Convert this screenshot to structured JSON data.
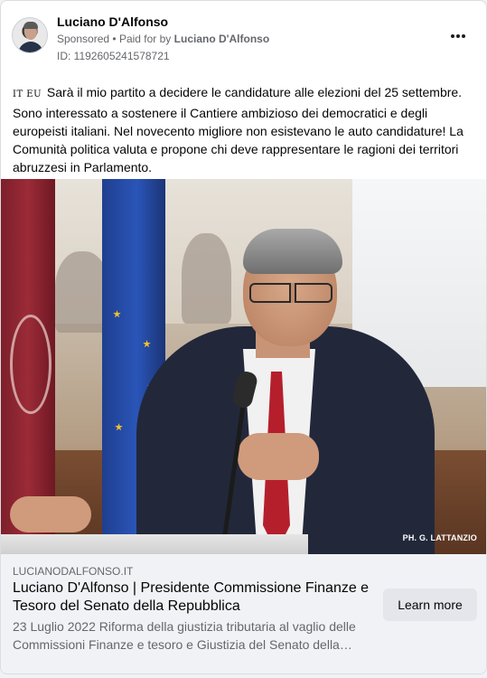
{
  "ad": {
    "page_name": "Luciano D'Alfonso",
    "sponsored_label": "Sponsored",
    "separator": "•",
    "paid_for_prefix": "Paid for by",
    "paid_for_name": "Luciano D'Alfonso",
    "library_id": "ID: 1192605241578721",
    "more_icon": "more-horizontal-icon"
  },
  "body": {
    "flags": "IT EU",
    "text": "Sarà il mio partito a decidere le candidature alle elezioni del 25 settembre. Sono interessato a sostenere il Cantiere ambizioso dei democratici e degli europeisti italiani. Nel novecento migliore non esistevano le auto candidature! La Comunità politica valuta e propone chi deve rappresentare le ragioni dei territori abruzzesi in Parlamento."
  },
  "image": {
    "credit": "PH. G. LATTANZIO"
  },
  "link": {
    "domain": "LUCIANODALFONSO.IT",
    "title": "Luciano D'Alfonso | Presidente Commissione Finanze e Tesoro del Senato della Repubblica",
    "description": "23 Luglio 2022 Riforma della giustizia tributaria al vaglio delle Commissioni Finanze e tesoro e Giustizia del Senato della…",
    "cta_label": "Learn more"
  },
  "colors": {
    "background": "#f0f2f5",
    "card": "#ffffff",
    "secondary_text": "#65676b",
    "button_bg": "#e4e6eb"
  }
}
